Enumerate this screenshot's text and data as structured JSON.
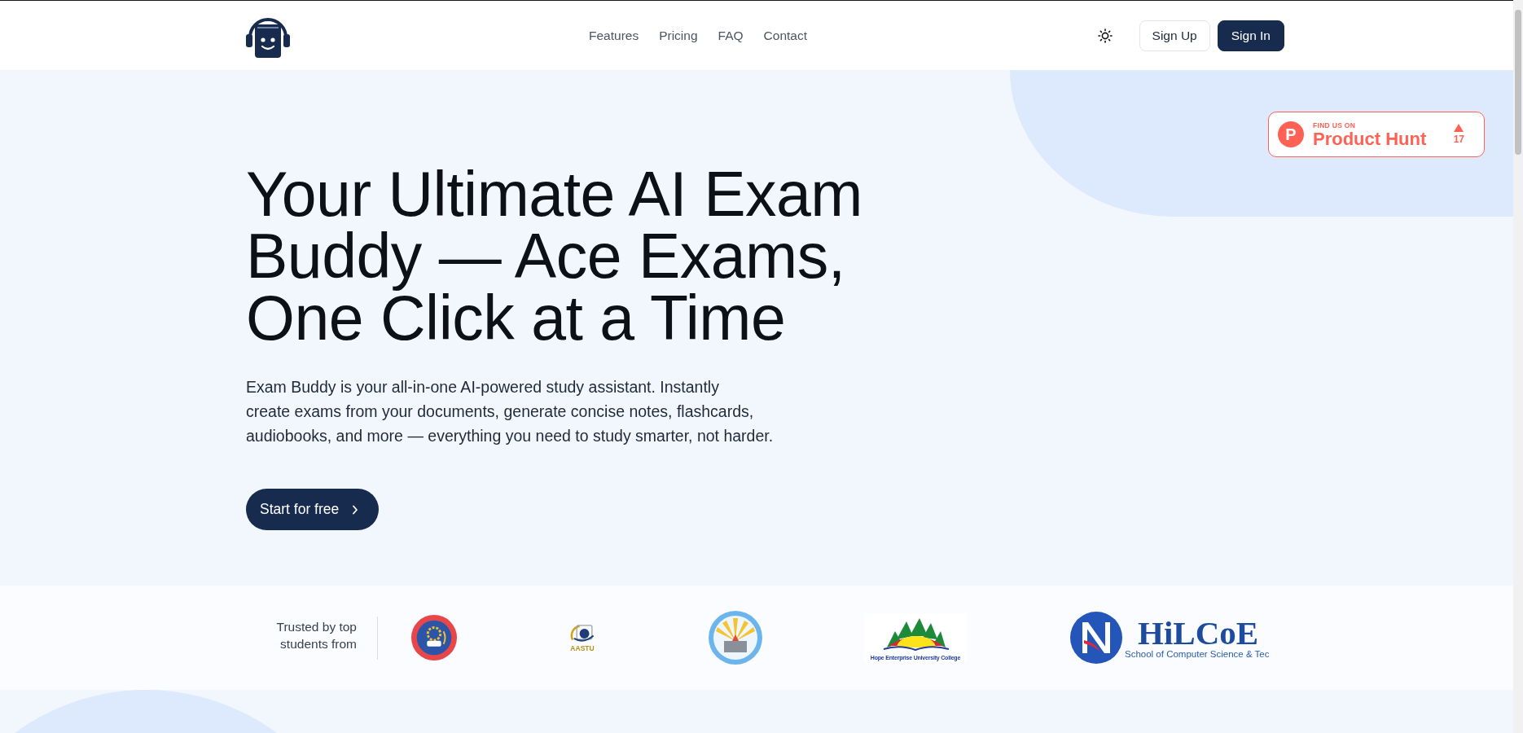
{
  "header": {
    "nav": [
      {
        "label": "Features"
      },
      {
        "label": "Pricing"
      },
      {
        "label": "FAQ"
      },
      {
        "label": "Contact"
      }
    ],
    "actions": [
      {
        "label": "Sign Up",
        "kind": "outline"
      },
      {
        "label": "Sign In",
        "kind": "solid"
      }
    ]
  },
  "product_hunt": {
    "mark": "P",
    "eyebrow": "FIND US ON",
    "name": "Product Hunt",
    "votes": "17"
  },
  "hero": {
    "title_lines": [
      "Your Ultimate AI Exam",
      "Buddy — Ace Exams,",
      "One Click at a Time"
    ],
    "description_lines": [
      "Exam Buddy is your all-in-one AI-powered study assistant. Instantly",
      "create exams from your documents, generate concise notes, flashcards,",
      "audiobooks, and more — everything you need to study smarter, not harder."
    ],
    "cta": "Start for free"
  },
  "trusted": {
    "label": "Trusted by top students from",
    "logos": [
      {
        "kind": "ring-seal"
      },
      {
        "kind": "emblem",
        "caption": "AASTU"
      },
      {
        "kind": "sun-seal"
      },
      {
        "kind": "sunburst",
        "caption": "Hope Enterprise University College"
      },
      {
        "kind": "monogram",
        "wordmark": "HiLCoE",
        "caption": "School of Computer Science & Tec"
      }
    ]
  }
}
